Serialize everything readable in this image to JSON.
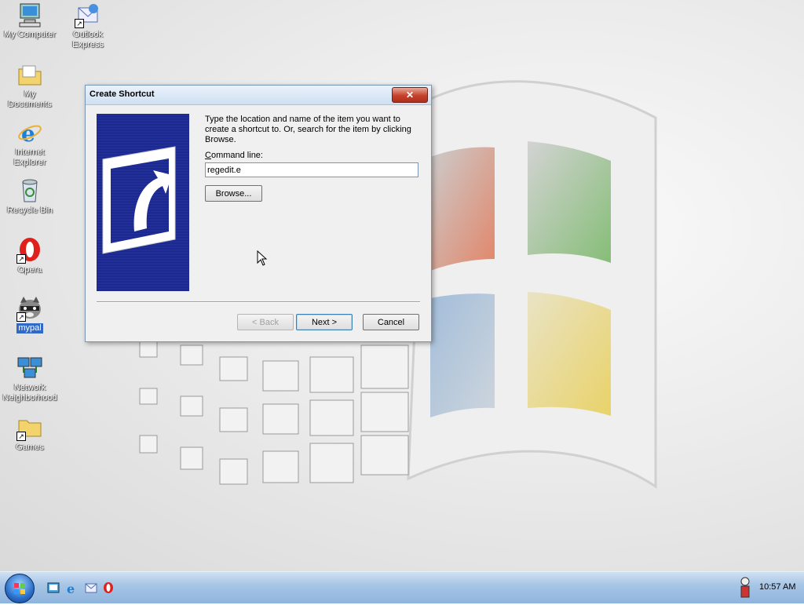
{
  "desktop": {
    "icons": [
      {
        "label": "My Computer",
        "icon": "computer-icon"
      },
      {
        "label": "Outlook Express",
        "icon": "outlook-express-icon"
      },
      {
        "label": "My Documents",
        "icon": "documents-folder-icon"
      },
      {
        "label": "Internet Explorer",
        "icon": "internet-explorer-icon"
      },
      {
        "label": "Recycle Bin",
        "icon": "recycle-bin-icon"
      },
      {
        "label": "Opera",
        "icon": "opera-icon"
      },
      {
        "label": "mypal",
        "icon": "mypal-raccoon-icon"
      },
      {
        "label": "Network Neighborhood",
        "icon": "network-icon"
      },
      {
        "label": "Games",
        "icon": "folder-icon"
      }
    ]
  },
  "dialog": {
    "title": "Create Shortcut",
    "close_label": "✕",
    "instructions": "Type the location and name of the item you want to create a shortcut to. Or, search for the item by clicking Browse.",
    "command_label": "Command line:",
    "command_value": "regedit.e",
    "browse_label": "Browse...",
    "back_label": "< Back",
    "next_label": "Next >",
    "cancel_label": "Cancel"
  },
  "taskbar": {
    "clock": "10:57 AM",
    "quick_launch": [
      "show-desktop-icon",
      "internet-explorer-icon",
      "outlook-express-icon",
      "opera-icon"
    ],
    "tray": [
      "messenger-tray-icon"
    ]
  },
  "colors": {
    "wizard_blue": "#1c2c9c",
    "selection": "#316ac5",
    "close_red": "#c5412b"
  }
}
